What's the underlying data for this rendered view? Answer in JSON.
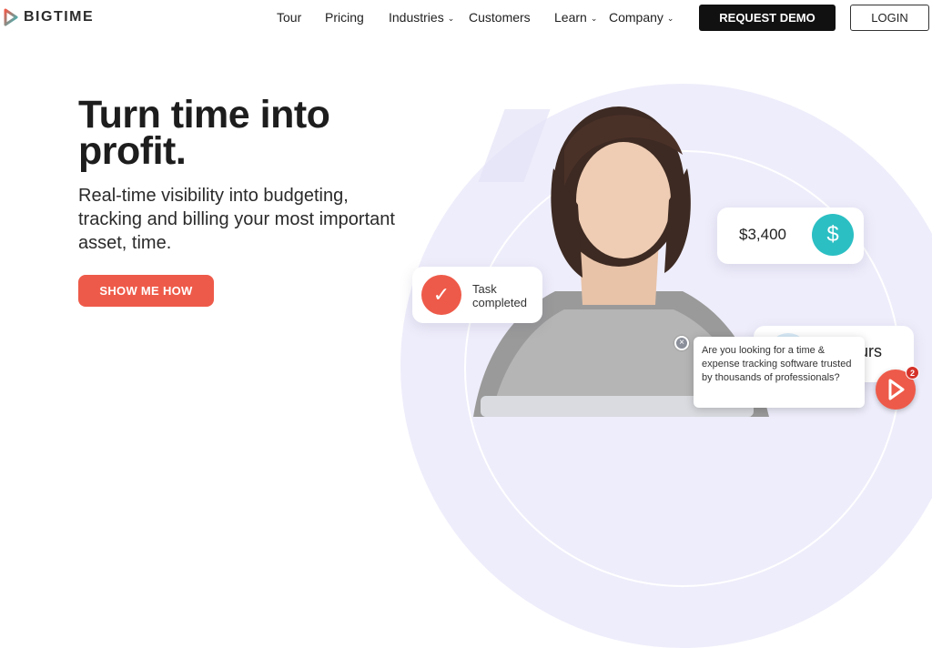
{
  "brand": {
    "name": "BIGTIME"
  },
  "nav": {
    "tour": "Tour",
    "pricing": "Pricing",
    "industries": "Industries",
    "customers": "Customers",
    "learn": "Learn",
    "company": "Company",
    "request_demo": "REQUEST DEMO",
    "login": "LOGIN"
  },
  "hero": {
    "title": "Turn time into profit.",
    "subtitle": "Real-time visibility into budgeting, tracking and billing your most important asset, time.",
    "cta": "SHOW ME HOW"
  },
  "cards": {
    "task_line1": "Task",
    "task_line2": "completed",
    "amount": "$3,400",
    "hours_partial": "urs"
  },
  "chat": {
    "message": "Are you looking for a time & expense tracking software trusted by thousands of professionals?",
    "badge_count": "2"
  },
  "colors": {
    "accent": "#ee5a49",
    "teal": "#2bbfc3",
    "dark": "#111111",
    "lavender": "#eeedfb"
  }
}
